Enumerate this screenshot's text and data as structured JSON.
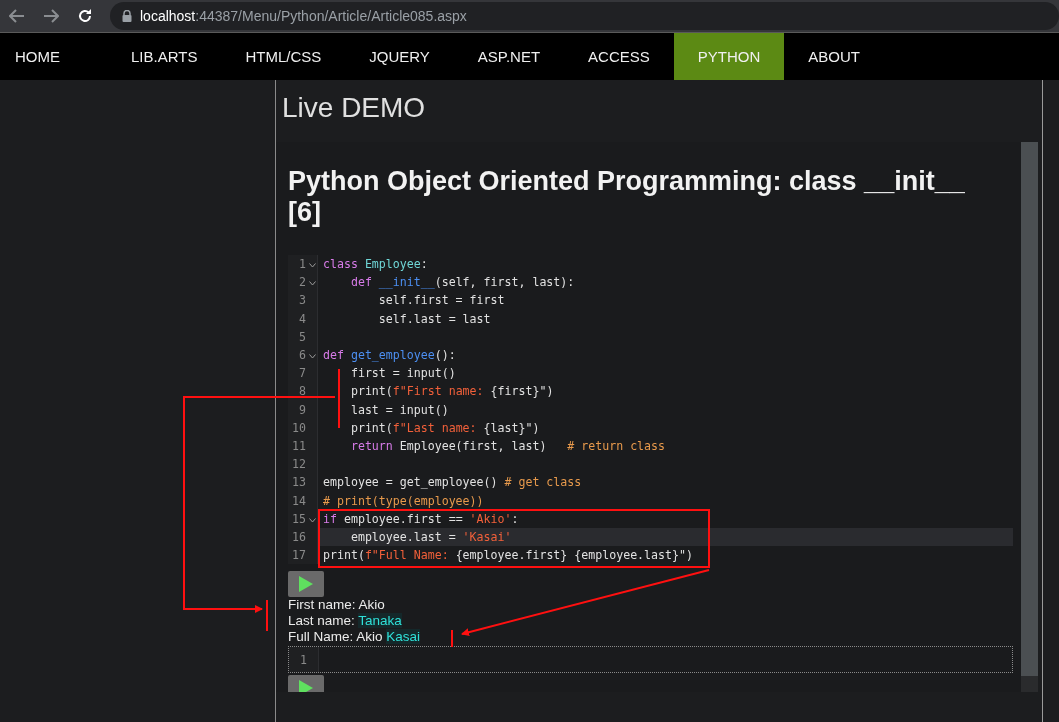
{
  "browser": {
    "url_host": "localhost",
    "url_path": ":44387/Menu/Python/Article/Article085.aspx"
  },
  "nav": [
    {
      "label": "HOME",
      "selected": false
    },
    {
      "label": "LIB.ARTS",
      "selected": false
    },
    {
      "label": "HTML/CSS",
      "selected": false
    },
    {
      "label": "JQUERY",
      "selected": false
    },
    {
      "label": "ASP.NET",
      "selected": false
    },
    {
      "label": "ACCESS",
      "selected": false
    },
    {
      "label": "PYTHON",
      "selected": true
    },
    {
      "label": "ABOUT",
      "selected": false
    }
  ],
  "heading": "Live DEMO",
  "demo": {
    "title": "Python Object Oriented Programming: class __init__ [6]",
    "editor": {
      "lines": [
        {
          "number": "1",
          "fold": true,
          "active": false,
          "tokens": [
            {
              "text": "class ",
              "kind": "keyword"
            },
            {
              "text": "Employee",
              "kind": "class"
            },
            {
              "text": ":",
              "kind": "plain"
            }
          ]
        },
        {
          "number": "2",
          "fold": true,
          "active": false,
          "tokens": [
            {
              "text": "    def ",
              "kind": "keyword"
            },
            {
              "text": "__init__",
              "kind": "function"
            },
            {
              "text": "(self, first, last):",
              "kind": "plain"
            }
          ]
        },
        {
          "number": "3",
          "fold": false,
          "active": false,
          "tokens": [
            {
              "text": "        self.first = first",
              "kind": "plain"
            }
          ]
        },
        {
          "number": "4",
          "fold": false,
          "active": false,
          "tokens": [
            {
              "text": "        self.last = last",
              "kind": "plain"
            }
          ]
        },
        {
          "number": "5",
          "fold": false,
          "active": false
        },
        {
          "number": "6",
          "fold": true,
          "active": false,
          "tokens": [
            {
              "text": "def ",
              "kind": "keyword"
            },
            {
              "text": "get_employee",
              "kind": "function"
            },
            {
              "text": "():",
              "kind": "plain"
            }
          ]
        },
        {
          "number": "7",
          "fold": false,
          "active": false,
          "tokens": [
            {
              "text": "    first = input()",
              "kind": "plain"
            }
          ]
        },
        {
          "number": "8",
          "fold": false,
          "active": false,
          "tokens": [
            {
              "text": "    print(",
              "kind": "plain"
            },
            {
              "text": "f\"First name: ",
              "kind": "string"
            },
            {
              "text": "{first}\")",
              "kind": "plain"
            }
          ]
        },
        {
          "number": "9",
          "fold": false,
          "active": false,
          "tokens": [
            {
              "text": "    last = input()",
              "kind": "plain"
            }
          ]
        },
        {
          "number": "10",
          "fold": false,
          "active": false,
          "tokens": [
            {
              "text": "    print(",
              "kind": "plain"
            },
            {
              "text": "f\"Last name: ",
              "kind": "string"
            },
            {
              "text": "{last}\")",
              "kind": "plain"
            }
          ]
        },
        {
          "number": "11",
          "fold": false,
          "active": false,
          "tokens": [
            {
              "text": "    return ",
              "kind": "keyword"
            },
            {
              "text": "Employee(first, last)   ",
              "kind": "plain"
            },
            {
              "text": "# return class",
              "kind": "comment"
            }
          ]
        },
        {
          "number": "12",
          "fold": false,
          "active": false
        },
        {
          "number": "13",
          "fold": false,
          "active": false,
          "tokens": [
            {
              "text": "employee = get_employee() ",
              "kind": "plain"
            },
            {
              "text": "# get class",
              "kind": "comment"
            }
          ]
        },
        {
          "number": "14",
          "fold": false,
          "active": false,
          "tokens": [
            {
              "text": "# print(type(employee))",
              "kind": "comment"
            }
          ]
        },
        {
          "number": "15",
          "fold": true,
          "active": false,
          "tokens": [
            {
              "text": "if ",
              "kind": "keyword"
            },
            {
              "text": "employee.first == ",
              "kind": "plain"
            },
            {
              "text": "'Akio'",
              "kind": "string"
            },
            {
              "text": ":",
              "kind": "plain"
            }
          ]
        },
        {
          "number": "16",
          "fold": false,
          "active": true,
          "tokens": [
            {
              "text": "    employee.last = ",
              "kind": "plain"
            },
            {
              "text": "'Kasai'",
              "kind": "string"
            }
          ]
        },
        {
          "number": "17",
          "fold": false,
          "active": false,
          "tokens": [
            {
              "text": "print(",
              "kind": "plain"
            },
            {
              "text": "f\"Full Name: ",
              "kind": "string"
            },
            {
              "text": "{employee.first} {employee.last}\")",
              "kind": "plain"
            }
          ]
        }
      ]
    },
    "output": [
      {
        "segments": [
          {
            "text": "First name: Akio",
            "kind": "text"
          }
        ]
      },
      {
        "segments": [
          {
            "text": "Last name: ",
            "kind": "text"
          },
          {
            "text": "Tanaka",
            "kind": "input"
          }
        ]
      },
      {
        "segments": [
          {
            "text": "Full Name: Akio ",
            "kind": "text"
          },
          {
            "text": "Kasai",
            "kind": "input"
          }
        ]
      }
    ],
    "input_editor": {
      "lines": [
        {
          "number": "1"
        }
      ]
    }
  }
}
